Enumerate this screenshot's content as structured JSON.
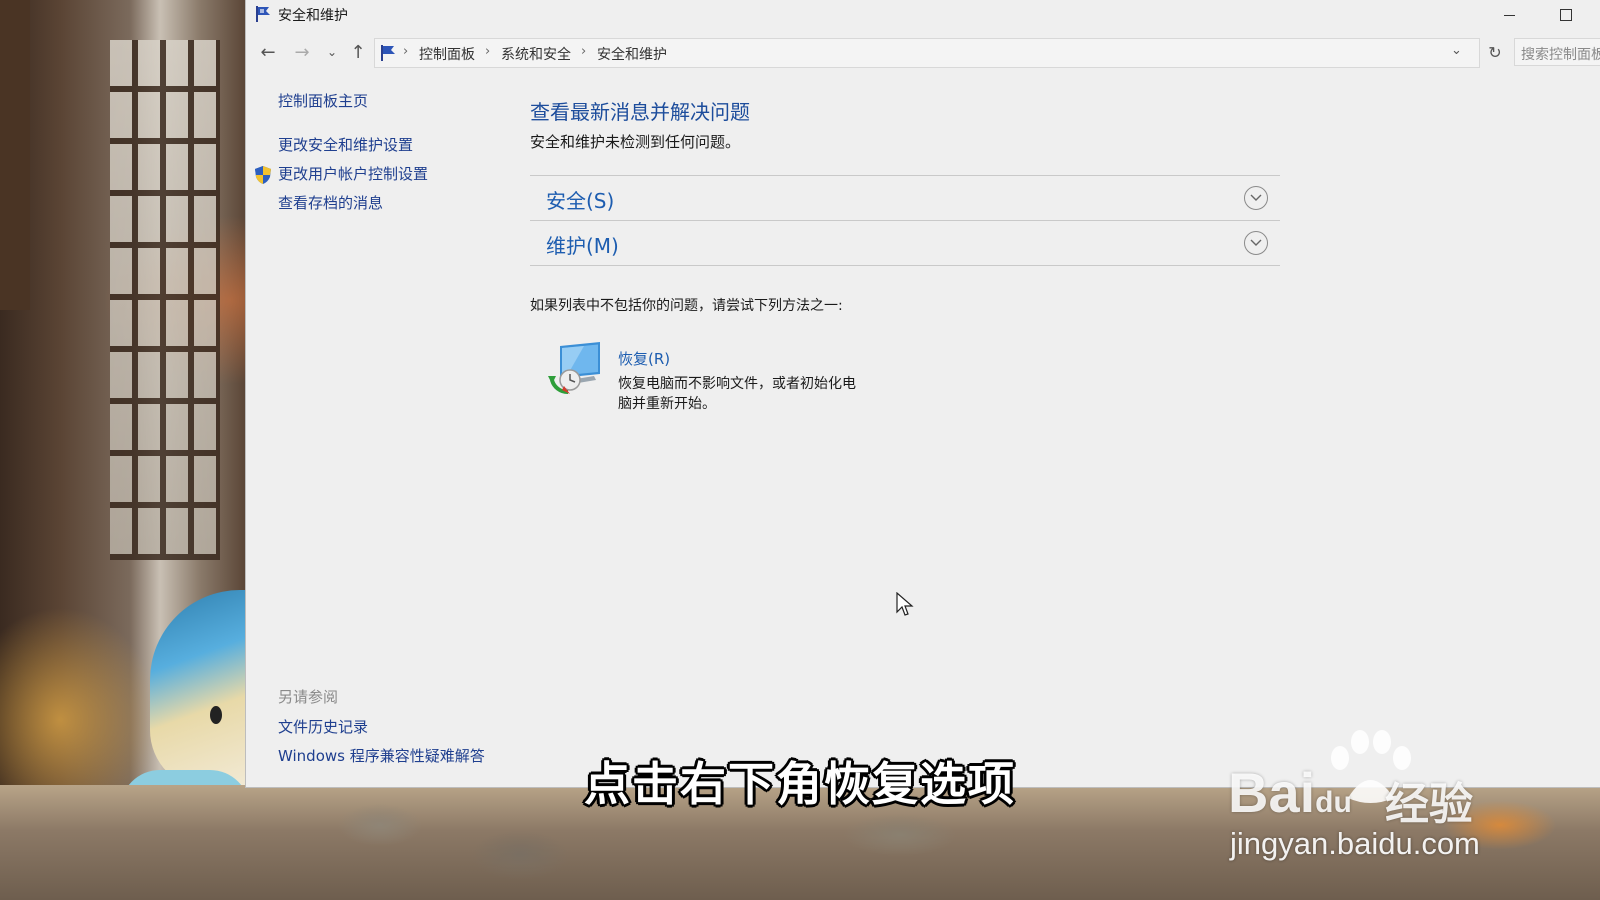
{
  "window": {
    "title": "安全和维护",
    "icon": "flag-icon"
  },
  "address_bar": {
    "breadcrumbs": [
      "控制面板",
      "系统和安全",
      "安全和维护"
    ],
    "search_placeholder": "搜索控制面板"
  },
  "left_nav": {
    "items": [
      {
        "label": "控制面板主页"
      },
      {
        "label": "更改安全和维护设置"
      },
      {
        "label": "更改用户帐户控制设置",
        "icon": "uac-shield-icon"
      },
      {
        "label": "查看存档的消息"
      }
    ],
    "see_also_heading": "另请参阅",
    "see_also": [
      {
        "label": "文件历史记录"
      },
      {
        "label": "Windows 程序兼容性疑难解答"
      }
    ]
  },
  "main": {
    "title": "查看最新消息并解决问题",
    "status": "安全和维护未检测到任何问题。",
    "sections": [
      {
        "label": "安全(S)"
      },
      {
        "label": "维护(M)"
      }
    ],
    "hint": "如果列表中不包括你的问题，请尝试下列方法之一:",
    "recovery": {
      "link": "恢复(R)",
      "description": "恢复电脑而不影响文件，或者初始化电脑并重新开始。",
      "icon": "recovery-icon"
    }
  },
  "overlay": {
    "subtitle": "点击右下角恢复选项",
    "watermark_logo": "Bai",
    "watermark_logo_suffix": "du",
    "watermark_cn": "经验",
    "watermark_url": "jingyan.baidu.com"
  },
  "colors": {
    "link": "#1d5db0",
    "title": "#1d4d9c",
    "window_bg": "#efefef"
  }
}
